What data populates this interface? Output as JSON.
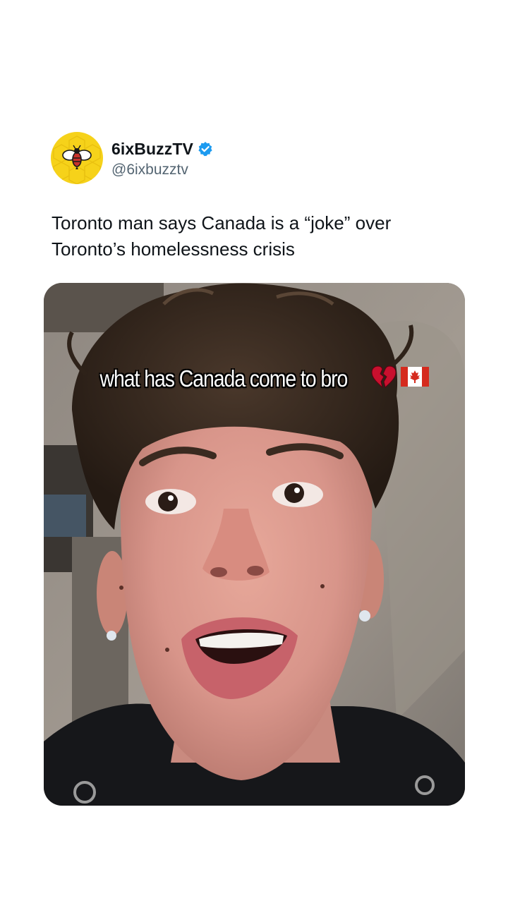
{
  "post": {
    "author": {
      "display_name": "6ixBuzzTV",
      "handle": "@6ixbuzztv",
      "verified": true,
      "avatar_icon": "bee-logo-icon",
      "avatar_color": "#f6d21a"
    },
    "text": "Toronto man says Canada is a “joke” over Toronto’s homelessness crisis",
    "media": {
      "type": "video-still",
      "caption": "what has Canada come to bro",
      "caption_emojis": [
        "broken-heart-icon",
        "canada-flag-icon"
      ]
    }
  },
  "colors": {
    "text_primary": "#0f1419",
    "text_secondary": "#536471",
    "verified_blue": "#1d9bf0",
    "background": "#ffffff"
  }
}
